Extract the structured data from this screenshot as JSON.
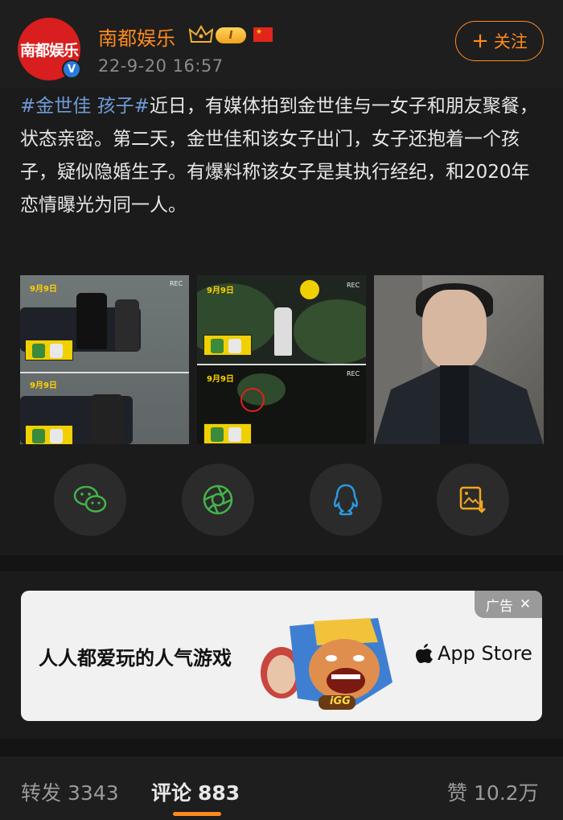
{
  "account": {
    "avatar_text": "南都娱乐",
    "name": "南都娱乐",
    "level_badge": "I",
    "post_time": "22-9-20 16:57",
    "follow_label": "关注"
  },
  "post": {
    "hashtag": "#金世佳 孩子#",
    "text": "近日，有媒体拍到金世佳与一女子和朋友聚餐，状态亲密。第二天，金世佳和该女子出门，女子还抱着一个孩子，疑似隐婚生子。有爆料称该女子是其执行经纪，和2020年恋情曝光为同一人。"
  },
  "media": [
    {
      "rec": "REC",
      "date_top": "9月9日",
      "date_bottom": "9月9日"
    },
    {
      "rec": "REC",
      "date_top": "9月9日",
      "date_bottom": "9月9日"
    }
  ],
  "share": [
    {
      "icon": "wechat-icon"
    },
    {
      "icon": "moments-icon"
    },
    {
      "icon": "qq-icon"
    },
    {
      "icon": "save-image-icon"
    }
  ],
  "ad": {
    "tag": "广告",
    "close": "✕",
    "headline": "人人都爱玩的人气游戏",
    "game_badge": "iGG",
    "store": "App Store"
  },
  "actions": {
    "repost_label": "转发",
    "repost_count": "3343",
    "comment_label": "评论",
    "comment_count": "883",
    "like_label": "赞",
    "like_count": "10.2万"
  },
  "colors": {
    "accent": "#ff8a1f",
    "hashtag": "#6f9bd6",
    "background": "#1b1b1b"
  }
}
